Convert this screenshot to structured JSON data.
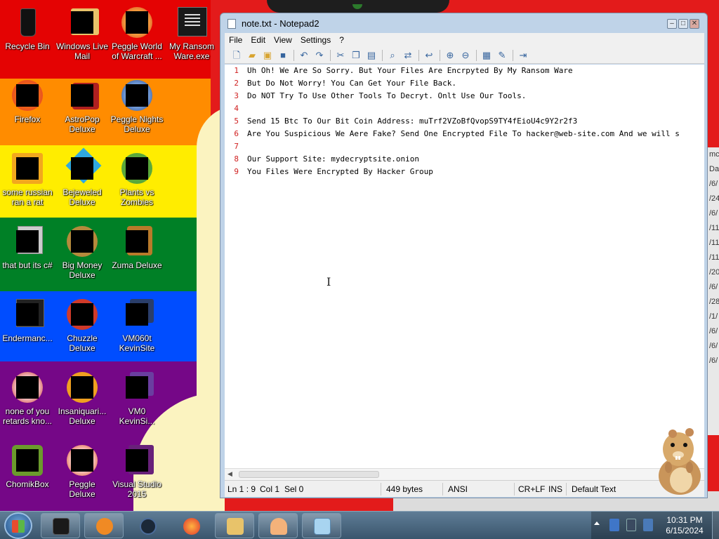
{
  "desktop": {
    "icons": [
      {
        "label": "Recycle Bin"
      },
      {
        "label": "Windows Live Mail"
      },
      {
        "label": "Peggle World of Warcraft ..."
      },
      {
        "label": "My Ransom Ware.exe"
      },
      {
        "label": "Firefox"
      },
      {
        "label": "AstroPop Deluxe"
      },
      {
        "label": "Peggle Nights Deluxe"
      },
      {
        "label": "some russian ran a rat"
      },
      {
        "label": "Bejeweled Deluxe"
      },
      {
        "label": "Plants vs Zombies"
      },
      {
        "label": "that but its c#"
      },
      {
        "label": "Big Money Deluxe"
      },
      {
        "label": "Zuma Deluxe"
      },
      {
        "label": "Endermanc..."
      },
      {
        "label": "Chuzzle Deluxe"
      },
      {
        "label": "VM060t KevinSite"
      },
      {
        "label": "none of you retards kno..."
      },
      {
        "label": "Insaniquari... Deluxe"
      },
      {
        "label": "VM0 KevinSi..."
      },
      {
        "label": "ChomikBox"
      },
      {
        "label": "Peggle Deluxe"
      },
      {
        "label": "Visual Studio 2015"
      }
    ],
    "background_window_lines": [
      "mc",
      "Date",
      "/6/",
      "/24",
      "/6/",
      "/11",
      "/11",
      "/11",
      "/20",
      "/6/",
      "/28",
      "/1/",
      "/6/",
      "/6/",
      "/6/"
    ]
  },
  "notepad": {
    "title": "note.txt - Notepad2",
    "menu": [
      "File",
      "Edit",
      "View",
      "Settings",
      "?"
    ],
    "toolbar_icons": [
      "new-file-icon",
      "open-folder-icon",
      "browse-icon",
      "save-icon",
      "undo-icon",
      "redo-icon",
      "cut-icon",
      "copy-icon",
      "paste-icon",
      "find-icon",
      "replace-icon",
      "word-wrap-icon",
      "zoom-in-icon",
      "zoom-out-icon",
      "scheme-icon",
      "customize-scheme-icon",
      "exit-icon"
    ],
    "lines": [
      {
        "num": "1",
        "text": "Uh Oh! We Are So Sorry. But Your Files Are Encrpyted By My Ransom Ware"
      },
      {
        "num": "2",
        "text": "But Do Not Worry! You Can Get Your File Back."
      },
      {
        "num": "3",
        "text": "Do NOT Try To Use Other Tools To Decryt. Onlt Use Our Tools."
      },
      {
        "num": "4",
        "text": ""
      },
      {
        "num": "5",
        "text": "Send 15 Btc To Our Bit Coin Address: muTrf2VZoBfQvopS9TY4fEioU4c9Y2r2f3"
      },
      {
        "num": "6",
        "text": "Are You Suspicious We Aere Fake? Send One Encrypted File To hacker@web-site.com And we will s"
      },
      {
        "num": "7",
        "text": ""
      },
      {
        "num": "8",
        "text": "Our Support Site: mydecryptsite.onion"
      },
      {
        "num": "9",
        "text": "You Files Were Encrypted By Hacker Group"
      }
    ],
    "status": {
      "position": "Ln 1 : 9",
      "column": "Col 1",
      "selection": "Sel 0",
      "size": "449 bytes",
      "encoding": "ANSI",
      "line_ending": "CR+LF",
      "insert_mode": "INS",
      "scheme": "Default Text"
    }
  },
  "taskbar": {
    "clock_time": "10:31 PM",
    "clock_date": "6/15/2024",
    "buttons": [
      "terminal",
      "media-player",
      "steam",
      "firefox",
      "explorer",
      "user-app",
      "notepad2"
    ]
  }
}
